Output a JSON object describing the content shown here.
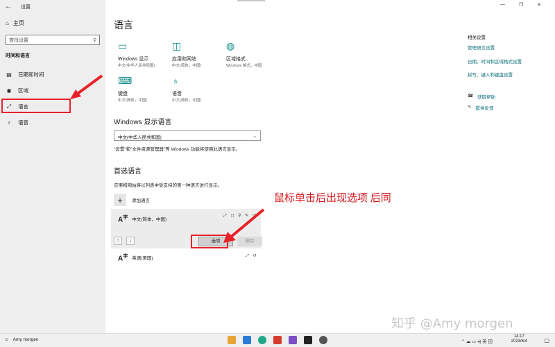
{
  "window": {
    "title": "设置",
    "back": "←",
    "controls": [
      "—",
      "❐",
      "✕"
    ]
  },
  "sidebar": {
    "home": "主页",
    "search_placeholder": "查找设置",
    "section": "时间和语言",
    "items": [
      {
        "label": "日期和时间",
        "icon": "calendar-clock-icon"
      },
      {
        "label": "区域",
        "icon": "globe-region-icon"
      },
      {
        "label": "语言",
        "icon": "language-icon"
      },
      {
        "label": "语音",
        "icon": "microphone-icon"
      }
    ]
  },
  "main": {
    "title": "语言",
    "tiles": [
      {
        "name": "Windows 显示",
        "desc": "中文(中华人民共和国)",
        "icon": "monitor-icon"
      },
      {
        "name": "应用和网站",
        "desc": "中文(简体，中国)",
        "icon": "app-window-icon"
      },
      {
        "name": "区域格式",
        "desc": "Windows 格式，中国",
        "icon": "region-format-icon"
      },
      {
        "name": "键盘",
        "desc": "中文(简体，中国)",
        "icon": "keyboard-icon"
      },
      {
        "name": "语音",
        "desc": "中文(简体，中国)",
        "icon": "microphone-icon"
      }
    ],
    "display_lang": {
      "heading": "Windows 显示语言",
      "selected": "中文(中华人民共和国)",
      "note": "\"设置\"和\"文件资源管理器\"等 Windows 功能将使用此语言显示。"
    },
    "preferred": {
      "heading": "首选语言",
      "note": "应用和网站将以列表中受支持的第一种语言进行显示。",
      "add": "添加语言",
      "langs": [
        {
          "name": "中文(简体，中国)",
          "flags": "⤢ ◻ ⚲ ✎ ↺"
        },
        {
          "name": "英语(美国)",
          "flags": "⤢ ↺"
        }
      ],
      "options_button": "选项",
      "remove_button": "删除",
      "up": "↑",
      "down": "↓"
    },
    "annotation": "鼠标单击后出现选项  后同"
  },
  "related": {
    "heading": "相关设置",
    "links": [
      "管理语言设置",
      "日期、时间和区域格式设置",
      "拼写、键入和键盘设置"
    ],
    "help": [
      {
        "label": "获取帮助",
        "icon": "help-chat-icon"
      },
      {
        "label": "提供反馈",
        "icon": "feedback-icon"
      }
    ]
  },
  "watermark": "知乎 @Amy morgen",
  "taskbar": {
    "user": "Amy morgen",
    "tray": "⌃  ☁  ▭  ◂)  英  田",
    "time": "14:17",
    "date": "2023/6/4"
  },
  "colors": {
    "accent": "#0e8a8a",
    "highlight": "#e8202a",
    "sidebar_bg": "#eeeeee"
  }
}
